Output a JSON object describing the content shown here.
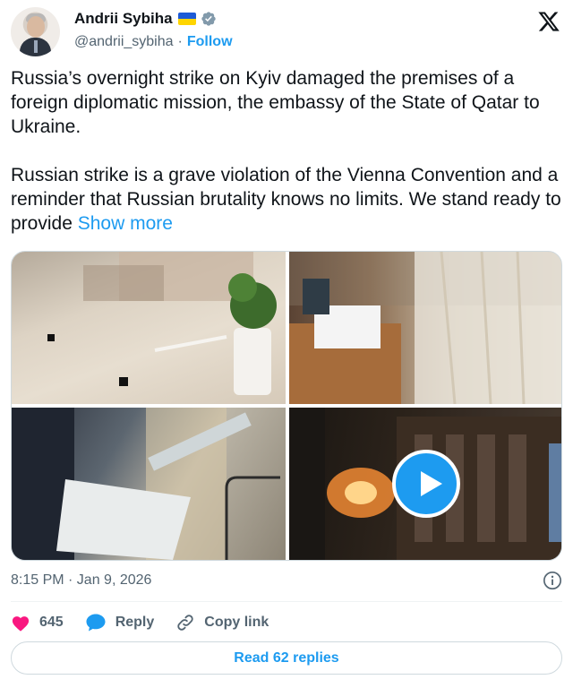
{
  "author": {
    "name": "Andrii Sybiha",
    "handle": "@andrii_sybiha",
    "separator": "·",
    "follow_label": "Follow"
  },
  "tweet": {
    "paragraph_1": "Russia’s overnight strike on Kyiv damaged the premises of a foreign diplomatic mission, the embassy of the State of Qatar to Ukraine.",
    "paragraph_2": "Russian strike is a grave violation of the Vienna Convention and a reminder that Russian brutality knows no limits. We stand ready to provide",
    "show_more": "Show more"
  },
  "media": {
    "items": [
      {
        "kind": "photo",
        "icon": "photo"
      },
      {
        "kind": "photo",
        "icon": "photo"
      },
      {
        "kind": "photo",
        "icon": "photo"
      },
      {
        "kind": "video",
        "icon": "play-icon"
      }
    ]
  },
  "meta": {
    "timestamp": "8:15 PM · Jan 9, 2026"
  },
  "actions": {
    "likes": "645",
    "reply_label": "Reply",
    "copy_link_label": "Copy link"
  },
  "footer": {
    "read_replies_label": "Read 62 replies"
  },
  "colors": {
    "accent": "#1d9bf0",
    "like": "#f91880",
    "muted": "#536471"
  }
}
